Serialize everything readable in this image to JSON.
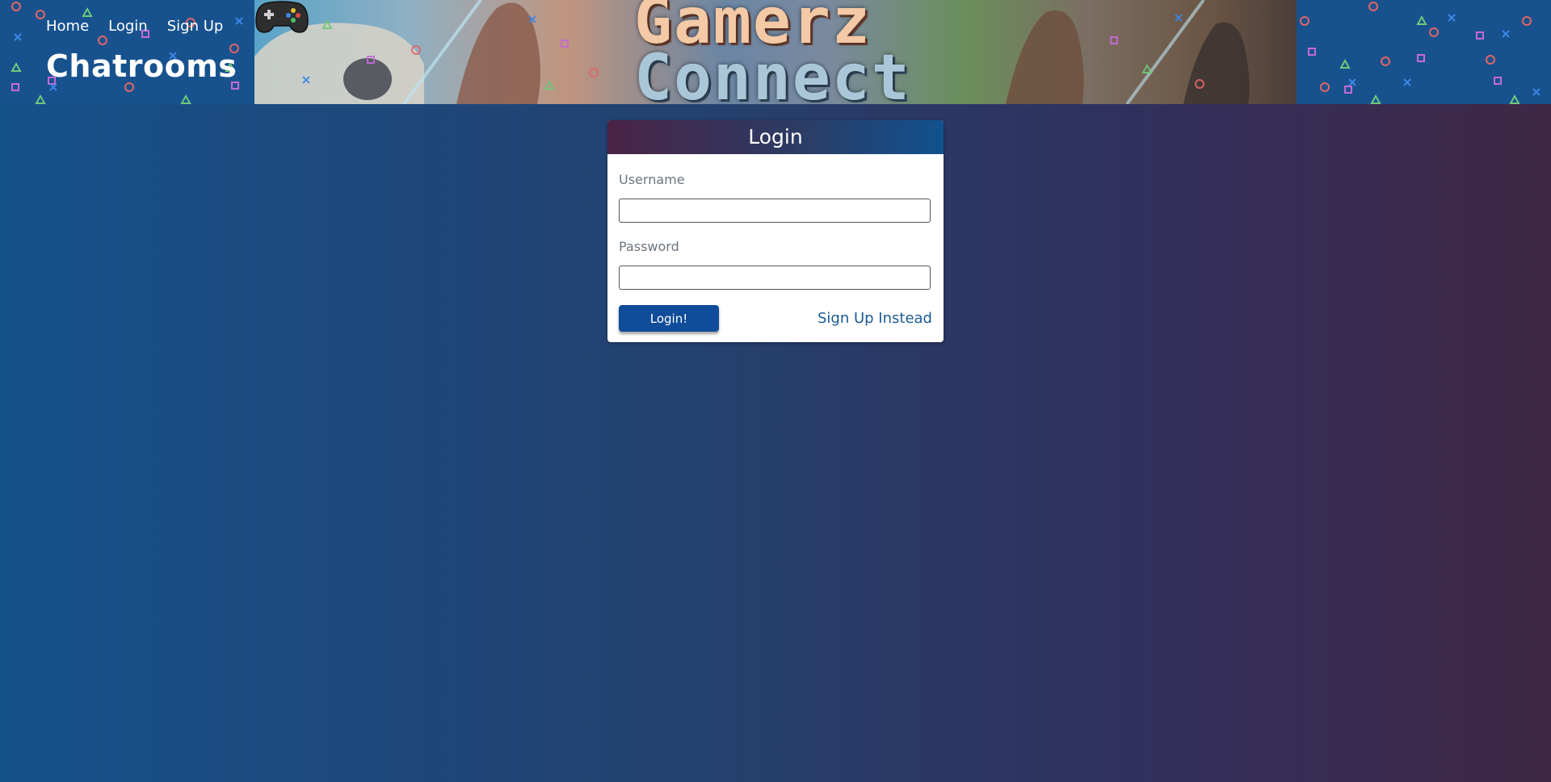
{
  "nav": {
    "items": [
      {
        "label": "Home"
      },
      {
        "label": "Login"
      },
      {
        "label": "Sign Up"
      }
    ]
  },
  "brand": {
    "title": "Chatrooms"
  },
  "banner": {
    "line1": "Gamerz",
    "line2": "Connect",
    "icon": "gamepad-icon"
  },
  "login": {
    "title": "Login",
    "username_label": "Username",
    "username_value": "",
    "password_label": "Password",
    "password_value": "",
    "submit_label": "Login!",
    "signup_link": "Sign Up Instead"
  },
  "colors": {
    "header_bg": "#17528e",
    "button": "#0f4c99",
    "link": "#1d5b93"
  }
}
